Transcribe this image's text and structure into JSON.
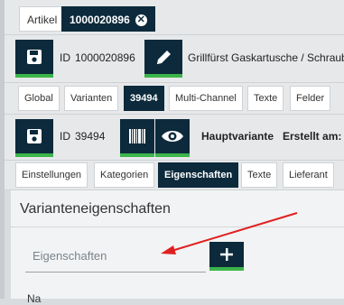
{
  "top_tabs": [
    {
      "label": "Artikel"
    },
    {
      "label": "1000020896"
    }
  ],
  "article": {
    "id_label": "ID",
    "id_value": "1000020896",
    "title": "Grillfürst Gaskartusche / Schraub"
  },
  "article_tabs": [
    {
      "label": "Global"
    },
    {
      "label": "Varianten"
    },
    {
      "label": "39494"
    },
    {
      "label": "Multi-Channel"
    },
    {
      "label": "Texte"
    },
    {
      "label": "Felder"
    }
  ],
  "variant": {
    "id_label": "ID",
    "id_value": "39494",
    "main_variant": "Hauptvariante",
    "created_label": "Erstellt am:"
  },
  "variant_tabs": [
    {
      "label": "Einstellungen"
    },
    {
      "label": "Kategorien"
    },
    {
      "label": "Eigenschaften"
    },
    {
      "label": "Texte"
    },
    {
      "label": "Lieferant"
    }
  ],
  "panel": {
    "title": "Varianteneigenschaften",
    "properties_placeholder": "Eigenschaften",
    "name_label": "Na"
  },
  "colors": {
    "dark": "#0c2a3b",
    "accent": "#3bb54a",
    "annotation": "#e02020"
  }
}
